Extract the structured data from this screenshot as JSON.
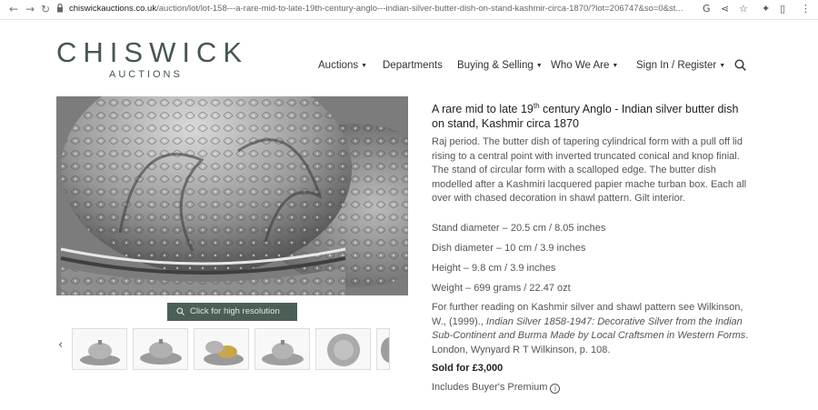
{
  "browser": {
    "url_domain": "chiswickauctions.co.uk",
    "url_path": "/auction/lot/lot-158---a-rare-mid-to-late-19th-century-anglo---indian-silver-butter-dish-on-stand-kashmir-circa-1870/?lot=206747&so=0&st...",
    "back_glyph": "←",
    "forward_glyph": "→",
    "reload_glyph": "↻",
    "toolbar_icons": [
      "G",
      "⋖",
      "☆",
      "✦",
      "▯",
      "⋮"
    ]
  },
  "header": {
    "logo_main": "CHISWICK",
    "logo_sub": "AUCTIONS",
    "nav": [
      {
        "label": "Auctions",
        "dropdown": true
      },
      {
        "label": "Departments",
        "dropdown": false
      },
      {
        "label": "Buying & Selling",
        "dropdown": true
      },
      {
        "label": "Who We Are",
        "dropdown": true
      },
      {
        "label": "Sign In / Register",
        "dropdown": true
      }
    ],
    "caret": "▼"
  },
  "gallery": {
    "hires_label": "Click for high resolution",
    "prev_arrow": "‹",
    "thumb_count": 6
  },
  "lot": {
    "title_pre": "A rare mid to late 19",
    "title_sup": "th",
    "title_post": " century Anglo - Indian silver butter dish on stand, Kashmir circa 1870",
    "description": "Raj period. The butter dish of tapering cylindrical form with a pull off lid rising to a central point with inverted truncated conical and knop finial. The stand of circular form with a scalloped edge. The butter dish modelled after a Kashmiri lacquered papier mache turban box. Each all over with chased decoration in shawl pattern. Gilt interior.",
    "specs": [
      "Stand diameter – 20.5 cm / 8.05 inches",
      "Dish diameter – 10 cm / 3.9 inches",
      "Height – 9.8 cm / 3.9 inches",
      "Weight – 699 grams / 22.47 ozt"
    ],
    "reading_pre": "For further reading on Kashmir silver and shawl pattern see Wilkinson, W., (1999)., ",
    "reading_italic": "Indian Silver 1858-1947: Decorative Silver from the Indian Sub-Continent and Burma Made by Local Craftsmen in Western Forms",
    "reading_post": ". London, Wynyard R T Wilkinson, p. 108.",
    "sold": "Sold for £3,000",
    "premium": "Includes Buyer's Premium",
    "info_glyph": "i"
  },
  "colors": {
    "brand": "#46574f",
    "button": "#4c5f57"
  }
}
